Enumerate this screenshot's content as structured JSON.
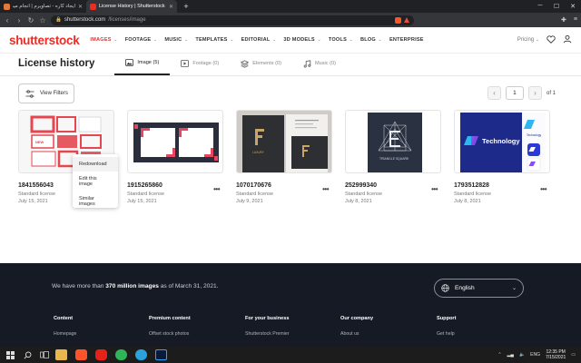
{
  "browser": {
    "tabs": [
      {
        "label": "ایجاد کاره - تصاویرم | انجام میدم",
        "active": false
      },
      {
        "label": "License History | Shutterstock",
        "active": true
      }
    ],
    "new_tab": "+",
    "url_host": "shutterstock.com",
    "url_path": "/licenses/image"
  },
  "site": {
    "logo": "shutterstock",
    "nav": [
      {
        "label": "IMAGES",
        "accent": true,
        "caret": true
      },
      {
        "label": "FOOTAGE",
        "caret": true
      },
      {
        "label": "MUSIC",
        "caret": true
      },
      {
        "label": "TEMPLATES",
        "caret": true
      },
      {
        "label": "EDITORIAL",
        "caret": true
      },
      {
        "label": "3D MODELS",
        "caret": true
      },
      {
        "label": "TOOLS",
        "caret": true
      },
      {
        "label": "BLOG",
        "caret": true
      },
      {
        "label": "ENTERPRISE",
        "caret": false
      }
    ],
    "pricing": "Pricing",
    "pricing_caret": "⌄"
  },
  "page": {
    "title": "License history",
    "tabs": [
      {
        "label": "Image (5)",
        "icon": "image-icon",
        "active": true
      },
      {
        "label": "Footage (0)",
        "icon": "video-icon",
        "active": false
      },
      {
        "label": "Elements (0)",
        "icon": "layers-icon",
        "active": false
      },
      {
        "label": "Music (0)",
        "icon": "music-icon",
        "active": false
      }
    ],
    "filters_label": "View Filters",
    "pager": {
      "prev": "‹",
      "current": "1",
      "next": "›",
      "of": "of 1"
    }
  },
  "cards": [
    {
      "id": "1841556043",
      "license": "Standard license",
      "date": "July 15, 2021"
    },
    {
      "id": "1915265860",
      "license": "Standard license",
      "date": "July 15, 2021"
    },
    {
      "id": "1070170676",
      "license": "Standard license",
      "date": "July 9, 2021"
    },
    {
      "id": "252999340",
      "license": "Standard license",
      "date": "July 8, 2021"
    },
    {
      "id": "1793512828",
      "license": "Standard license",
      "date": "July 8, 2021"
    }
  ],
  "card_menu_dots": "•••",
  "context_menu": [
    "Redownload",
    "Edit this image",
    "Similar images"
  ],
  "thumbnail_text": {
    "card3_brand": "LUXURY",
    "card4_caption": "TRIANGLE SQUARE",
    "card5_title": "Technology",
    "card5_sub": "Technology",
    "card1_overlay": "NEW"
  },
  "footer": {
    "tagline_pre": "We have more than ",
    "tagline_bold": "370 million images",
    "tagline_post": " as of March 31, 2021.",
    "language": "English",
    "columns": [
      {
        "head": "Content",
        "link": "Homepage"
      },
      {
        "head": "Premium content",
        "link": "Offset stock photos"
      },
      {
        "head": "For your business",
        "link": "Shutterstock Premier"
      },
      {
        "head": "Our company",
        "link": "About us"
      },
      {
        "head": "Support",
        "link": "Get help"
      }
    ]
  },
  "taskbar": {
    "language": "ENG",
    "time": "12:35 PM",
    "date": "7/15/2021"
  },
  "colors": {
    "brand": "#ee2b24",
    "footer_bg": "#161a25"
  }
}
